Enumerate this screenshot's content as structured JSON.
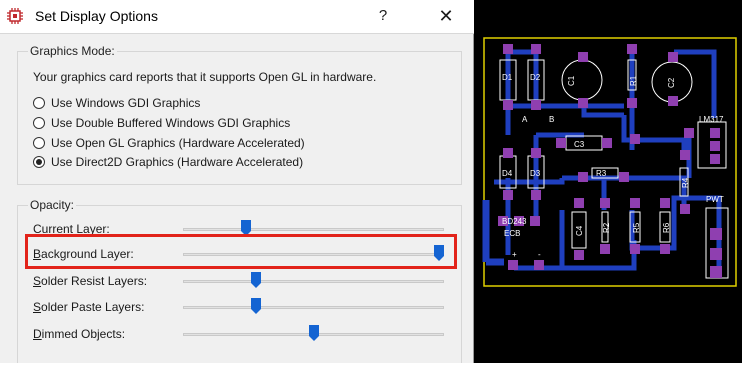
{
  "window": {
    "title": "Set Display Options",
    "help_label": "?",
    "close_label": "✕"
  },
  "graphics_mode": {
    "title": "Graphics Mode:",
    "description": "Your graphics card reports that it supports Open GL in hardware.",
    "options": [
      {
        "label": "Use Windows GDI Graphics",
        "selected": false
      },
      {
        "label": "Use Double Buffered Windows GDI Graphics",
        "selected": false
      },
      {
        "label": "Use Open GL Graphics (Hardware Accelerated)",
        "selected": false
      },
      {
        "label": "Use Direct2D Graphics (Hardware Accelerated)",
        "selected": true
      }
    ]
  },
  "opacity": {
    "title": "Opacity:",
    "sliders": [
      {
        "label": "Current Layer:",
        "access_key": "C",
        "rest": "urrent Layer:",
        "value": 0.23
      },
      {
        "label": "Background Layer:",
        "access_key": "B",
        "rest": "ackground Layer:",
        "value": 1.0
      },
      {
        "label": "Solder Resist Layers:",
        "access_key": "S",
        "rest": "older Resist Layers:",
        "value": 0.27
      },
      {
        "label": "Solder Paste Layers:",
        "access_key": "S",
        "rest": "older Paste Layers:",
        "value": 0.27
      },
      {
        "label": "Dimmed Objects:",
        "access_key": "D",
        "rest": "immed Objects:",
        "value": 0.5
      }
    ]
  },
  "pcb_preview": {
    "labels": [
      "D1",
      "D2",
      "C1",
      "R1",
      "C2",
      "A",
      "B",
      "C3",
      "LM317",
      "D4",
      "D3",
      "R3",
      "R4",
      "BD243",
      "ECB",
      "C4",
      "R2",
      "R5",
      "R6",
      "PWT",
      "+",
      "-"
    ],
    "colors": {
      "background": "#000000",
      "board_edge": "#e0d000",
      "trace": "#1f3fbf",
      "pad": "#8f3fb0",
      "silkscreen": "#ffffff"
    }
  },
  "colors": {
    "dialog_bg": "#f0f0f0",
    "highlight": "#e2231a",
    "slider_thumb": "#1464d2"
  }
}
